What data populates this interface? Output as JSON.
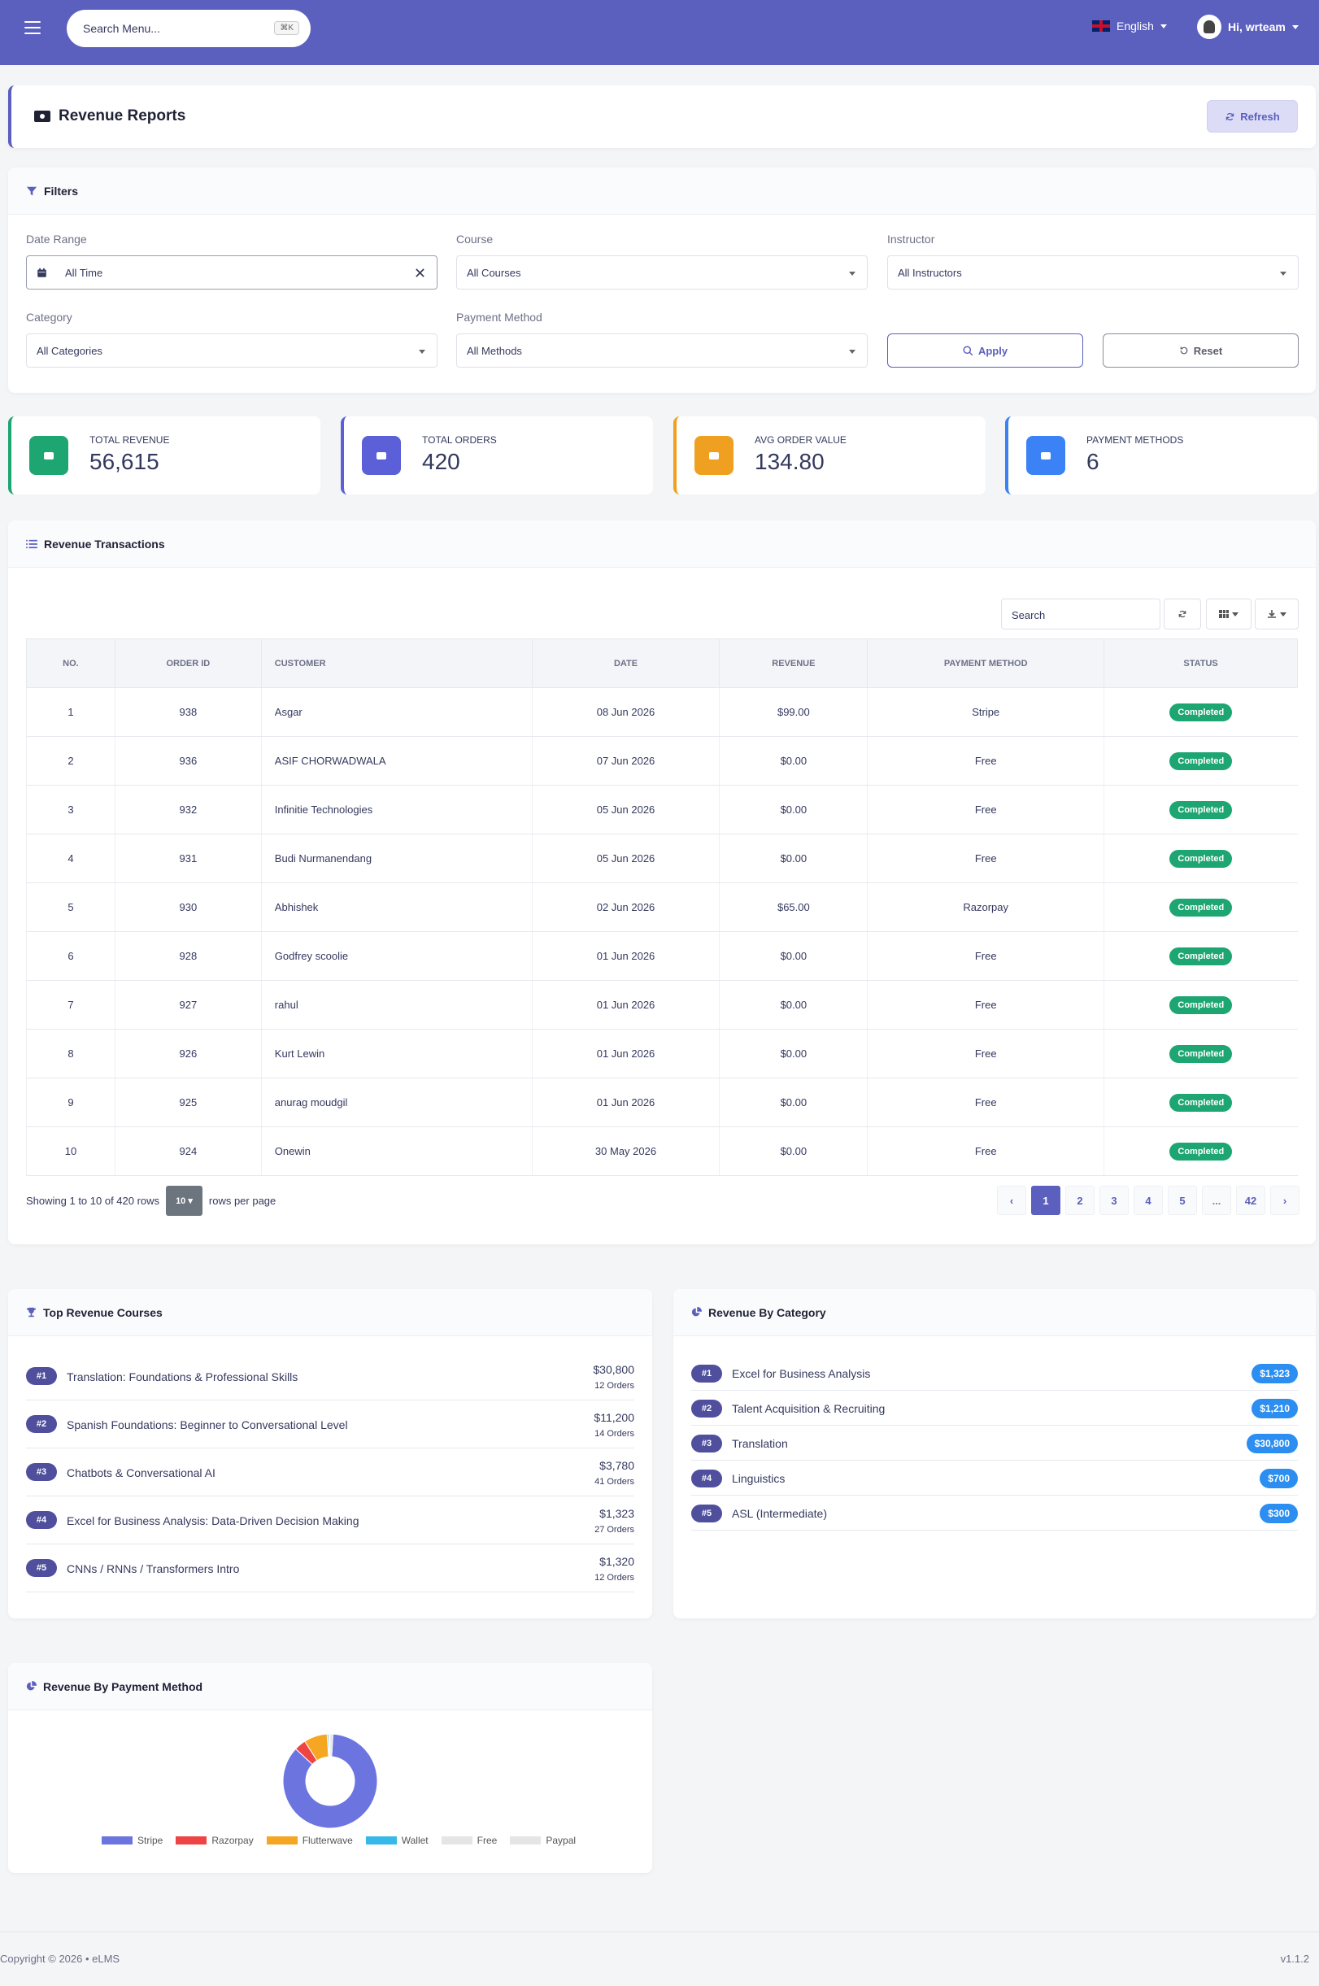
{
  "topbar": {
    "search_placeholder": "Search Menu...",
    "search_shortcut": "⌘K",
    "language": "English",
    "user_greeting": "Hi, wrteam"
  },
  "page": {
    "title": "Revenue Reports",
    "refresh_label": "Refresh"
  },
  "filters": {
    "title": "Filters",
    "date_range_label": "Date Range",
    "date_range_value": "All Time",
    "course_label": "Course",
    "course_value": "All Courses",
    "instructor_label": "Instructor",
    "instructor_value": "All Instructors",
    "category_label": "Category",
    "category_value": "All Categories",
    "payment_label": "Payment Method",
    "payment_value": "All Methods",
    "apply_label": "Apply",
    "reset_label": "Reset"
  },
  "stats": [
    {
      "label": "TOTAL REVENUE",
      "value": "56,615",
      "color": "#1ea672"
    },
    {
      "label": "TOTAL ORDERS",
      "value": "420",
      "color": "#5b5fd8"
    },
    {
      "label": "AVG ORDER VALUE",
      "value": "134.80",
      "color": "#f0a020"
    },
    {
      "label": "PAYMENT METHODS",
      "value": "6",
      "color": "#3b82f6"
    }
  ],
  "transactions": {
    "title": "Revenue Transactions",
    "search_placeholder": "Search",
    "columns": [
      "NO.",
      "ORDER ID",
      "CUSTOMER",
      "DATE",
      "REVENUE",
      "PAYMENT METHOD",
      "STATUS"
    ],
    "rows": [
      {
        "no": "1",
        "order_id": "938",
        "customer": "Asgar",
        "date": "08 Jun 2026",
        "revenue": "$99.00",
        "method": "Stripe",
        "status": "Completed"
      },
      {
        "no": "2",
        "order_id": "936",
        "customer": "ASIF CHORWADWALA",
        "date": "07 Jun 2026",
        "revenue": "$0.00",
        "method": "Free",
        "status": "Completed"
      },
      {
        "no": "3",
        "order_id": "932",
        "customer": "Infinitie Technologies",
        "date": "05 Jun 2026",
        "revenue": "$0.00",
        "method": "Free",
        "status": "Completed"
      },
      {
        "no": "4",
        "order_id": "931",
        "customer": "Budi Nurmanendang",
        "date": "05 Jun 2026",
        "revenue": "$0.00",
        "method": "Free",
        "status": "Completed"
      },
      {
        "no": "5",
        "order_id": "930",
        "customer": "Abhishek",
        "date": "02 Jun 2026",
        "revenue": "$65.00",
        "method": "Razorpay",
        "status": "Completed"
      },
      {
        "no": "6",
        "order_id": "928",
        "customer": "Godfrey scoolie",
        "date": "01 Jun 2026",
        "revenue": "$0.00",
        "method": "Free",
        "status": "Completed"
      },
      {
        "no": "7",
        "order_id": "927",
        "customer": "rahul",
        "date": "01 Jun 2026",
        "revenue": "$0.00",
        "method": "Free",
        "status": "Completed"
      },
      {
        "no": "8",
        "order_id": "926",
        "customer": "Kurt Lewin",
        "date": "01 Jun 2026",
        "revenue": "$0.00",
        "method": "Free",
        "status": "Completed"
      },
      {
        "no": "9",
        "order_id": "925",
        "customer": "anurag moudgil",
        "date": "01 Jun 2026",
        "revenue": "$0.00",
        "method": "Free",
        "status": "Completed"
      },
      {
        "no": "10",
        "order_id": "924",
        "customer": "Onewin",
        "date": "30 May 2026",
        "revenue": "$0.00",
        "method": "Free",
        "status": "Completed"
      }
    ],
    "showing_text": "Showing 1 to 10 of 420 rows",
    "per_page_value": "10",
    "per_page_suffix": "rows per page",
    "pages": [
      "‹",
      "1",
      "2",
      "3",
      "4",
      "5",
      "...",
      "42",
      "›"
    ],
    "active_page": "1"
  },
  "top_courses": {
    "title": "Top Revenue Courses",
    "items": [
      {
        "rank": "#1",
        "name": "Translation: Foundations & Professional Skills",
        "amount": "$30,800",
        "orders": "12 Orders"
      },
      {
        "rank": "#2",
        "name": "Spanish Foundations: Beginner to Conversational Level",
        "amount": "$11,200",
        "orders": "14 Orders"
      },
      {
        "rank": "#3",
        "name": "Chatbots & Conversational AI",
        "amount": "$3,780",
        "orders": "41 Orders"
      },
      {
        "rank": "#4",
        "name": "Excel for Business Analysis: Data-Driven Decision Making",
        "amount": "$1,323",
        "orders": "27 Orders"
      },
      {
        "rank": "#5",
        "name": "CNNs / RNNs / Transformers Intro",
        "amount": "$1,320",
        "orders": "12 Orders"
      }
    ]
  },
  "by_category": {
    "title": "Revenue By Category",
    "items": [
      {
        "rank": "#1",
        "name": "Excel for Business Analysis",
        "amount": "$1,323"
      },
      {
        "rank": "#2",
        "name": "Talent Acquisition & Recruiting",
        "amount": "$1,210"
      },
      {
        "rank": "#3",
        "name": "Translation",
        "amount": "$30,800"
      },
      {
        "rank": "#4",
        "name": "Linguistics",
        "amount": "$700"
      },
      {
        "rank": "#5",
        "name": "ASL (Intermediate)",
        "amount": "$300"
      }
    ]
  },
  "by_payment": {
    "title": "Revenue By Payment Method",
    "chart_data": {
      "type": "pie",
      "labels": [
        "Stripe",
        "Razorpay",
        "Flutterwave",
        "Wallet",
        "Free",
        "Paypal"
      ],
      "values": [
        86,
        4,
        8,
        0.5,
        0.5,
        1
      ],
      "colors": [
        "#6c74e0",
        "#ef4444",
        "#f5a623",
        "#36b9e8",
        "#e5e5e5",
        "#e5e5e5"
      ]
    }
  },
  "footer": {
    "copyright": "Copyright © 2026 • eLMS",
    "version": "v1.1.2"
  }
}
